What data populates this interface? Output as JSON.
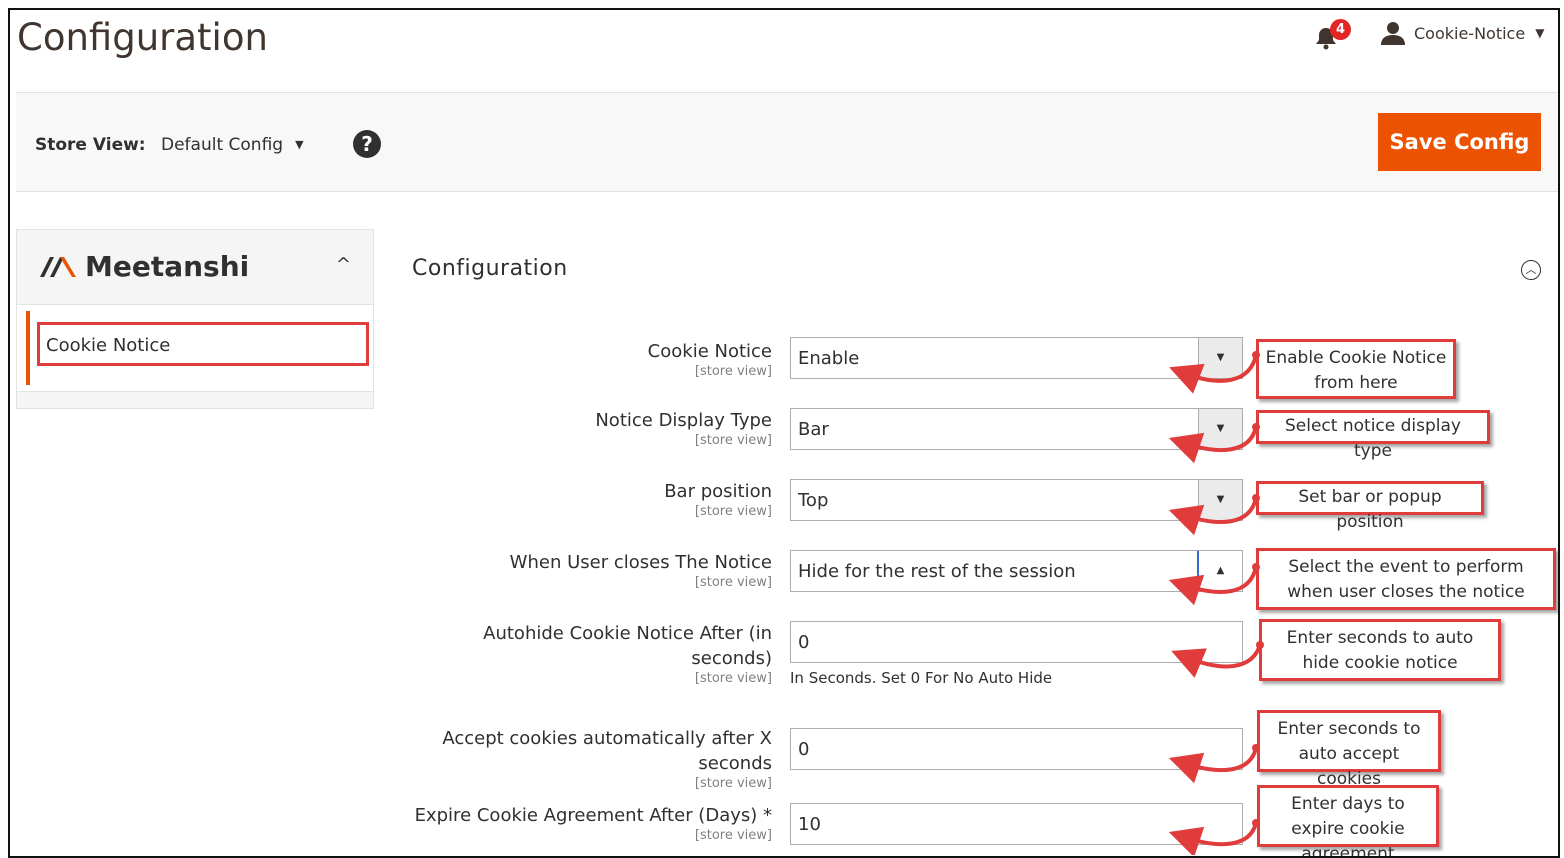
{
  "header": {
    "title": "Configuration",
    "notification_count": "4",
    "user_name": "Cookie-Notice"
  },
  "store_bar": {
    "label": "Store View:",
    "value": "Default Config",
    "save_label": "Save Config"
  },
  "sidebar": {
    "brand": "Meetanshi",
    "items": [
      {
        "label": "Cookie Notice"
      }
    ]
  },
  "section": {
    "title": "Configuration"
  },
  "fields": [
    {
      "label": "Cookie Notice",
      "scope": "[store view]",
      "type": "select",
      "value": "Enable",
      "callout": "Enable Cookie Notice from here"
    },
    {
      "label": "Notice Display Type",
      "scope": "[store view]",
      "type": "select",
      "value": "Bar",
      "callout": "Select notice display type"
    },
    {
      "label": "Bar position",
      "scope": "[store view]",
      "type": "select",
      "value": "Top",
      "callout": "Set bar or popup position"
    },
    {
      "label": "When User closes The Notice",
      "scope": "[store view]",
      "type": "select",
      "value": "Hide for the rest of the session",
      "callout": "Select the event to perform when user closes the notice"
    },
    {
      "label": "Autohide Cookie Notice After (in seconds)",
      "scope": "[store view]",
      "type": "text",
      "value": "0",
      "note": "In Seconds. Set 0 For No Auto Hide",
      "callout": "Enter seconds to auto hide cookie notice"
    },
    {
      "label": "Accept cookies automatically after X seconds",
      "scope": "[store view]",
      "type": "text",
      "value": "0",
      "callout": "Enter seconds to auto accept cookies"
    },
    {
      "label": "Expire Cookie Agreement After (Days) *",
      "scope": "[store view]",
      "type": "text",
      "value": "10",
      "callout": "Enter days to expire cookie agreement"
    }
  ],
  "colors": {
    "accent": "#eb5202",
    "annotation": "#e03c3c",
    "badge": "#e22626"
  },
  "icons": [
    "bell-icon",
    "user-icon",
    "help-icon",
    "chevron-up-icon",
    "collapse-circle-icon",
    "dropdown-caret-icon"
  ]
}
